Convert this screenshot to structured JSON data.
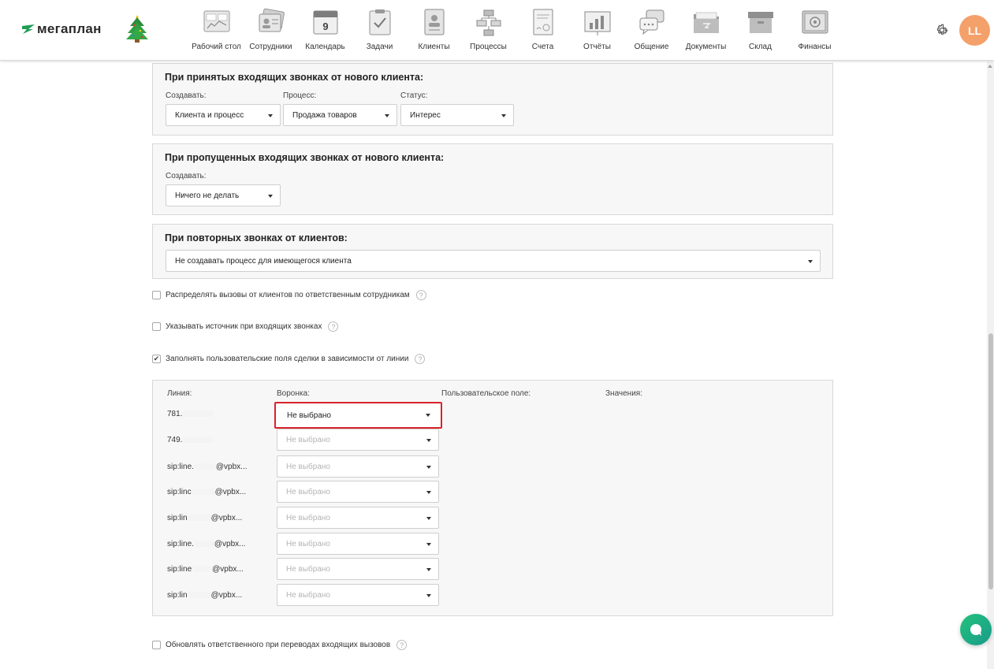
{
  "header": {
    "logo": "мегаплан",
    "nav": [
      {
        "label": "Рабочий стол",
        "icon": "dashboard-icon"
      },
      {
        "label": "Сотрудники",
        "icon": "employees-icon"
      },
      {
        "label": "Календарь",
        "icon": "calendar-icon",
        "day": "9"
      },
      {
        "label": "Задачи",
        "icon": "tasks-icon"
      },
      {
        "label": "Клиенты",
        "icon": "clients-icon"
      },
      {
        "label": "Процессы",
        "icon": "processes-icon"
      },
      {
        "label": "Счета",
        "icon": "invoices-icon"
      },
      {
        "label": "Отчёты",
        "icon": "reports-icon"
      },
      {
        "label": "Общение",
        "icon": "chat-icon"
      },
      {
        "label": "Документы",
        "icon": "documents-icon"
      },
      {
        "label": "Склад",
        "icon": "warehouse-icon"
      },
      {
        "label": "Финансы",
        "icon": "finance-icon"
      }
    ],
    "avatar_initials": "LL"
  },
  "accepted_calls": {
    "title": "При принятых входящих звонках от нового клиента:",
    "create_label": "Создавать:",
    "create_value": "Клиента и процесс",
    "process_label": "Процесс:",
    "process_value": "Продажа товаров",
    "status_label": "Статус:",
    "status_value": "Интерес"
  },
  "missed_calls": {
    "title": "При пропущенных входящих звонках от нового клиента:",
    "create_label": "Создавать:",
    "create_value": "Ничего не делать"
  },
  "repeat_calls": {
    "title": "При повторных звонках от клиентов:",
    "value": "Не создавать процесс для имеющегося клиента"
  },
  "options": {
    "distribute": "Распределять вызовы от клиентов по ответственным сотрудникам",
    "source": "Указывать источник при входящих звонках",
    "fill_fields": "Заполнять пользовательские поля сделки в зависимости от линии",
    "update_responsible": "Обновлять ответственного при переводах входящих вызовов",
    "help": "?"
  },
  "lines_table": {
    "col_line": "Линия:",
    "col_funnel": "Воронка:",
    "col_custom": "Пользовательское поле:",
    "col_values": "Значения:",
    "rows": [
      {
        "line": "781.",
        "funnel": "Не выбрано"
      },
      {
        "line": "749.",
        "funnel": "Не выбрано"
      },
      {
        "line": "sip:line.",
        "suffix": "@vpbx...",
        "funnel": "Не выбрано"
      },
      {
        "line": "sip:linc",
        "suffix": "@vpbx...",
        "funnel": "Не выбрано"
      },
      {
        "line": "sip:lin",
        "suffix": "@vpbx...",
        "funnel": "Не выбрано"
      },
      {
        "line": "sip:line.",
        "suffix": "@vpbx...",
        "funnel": "Не выбрано"
      },
      {
        "line": "sip:line",
        "suffix": "@vpbx...",
        "funnel": "Не выбрано"
      },
      {
        "line": "sip:lin",
        "suffix": "@vpbx...",
        "funnel": "Не выбрано"
      }
    ]
  }
}
